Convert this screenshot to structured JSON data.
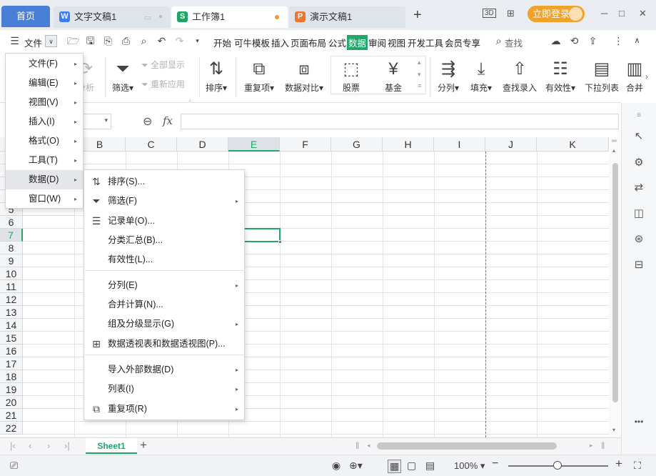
{
  "tabs": {
    "home": "首页",
    "docs": [
      {
        "label": "文字文稿1",
        "icon": "W",
        "color": "#3d7cf2"
      },
      {
        "label": "工作簿1",
        "icon": "S",
        "color": "#1fa463"
      },
      {
        "label": "演示文稿1",
        "icon": "P",
        "color": "#f0742d"
      }
    ],
    "add": "+"
  },
  "window": {
    "login": "立即登录",
    "minimize": "─",
    "maximize": "□",
    "close": "✕"
  },
  "menubar": {
    "file_label": "文件",
    "items": [
      "开始",
      "可牛模板",
      "插入",
      "页面布局",
      "公式",
      "数据",
      "审阅",
      "视图",
      "开发工具",
      "会员专享"
    ],
    "active": "数据",
    "search": "查找"
  },
  "ribbon": {
    "analysis_partial": "分析",
    "filter": "筛选",
    "show_all": "全部显示",
    "reapply": "重新应用",
    "sort": "排序",
    "duplicates": "重复项",
    "compare": "数据对比",
    "stock": "股票",
    "fund": "基金",
    "split": "分列",
    "fill": "填充",
    "lookup": "查找录入",
    "validity": "有效性",
    "dropdown": "下拉列表",
    "merge_partial": "合并"
  },
  "formula_bar": {
    "fx": "fx",
    "value": ""
  },
  "grid": {
    "columns": [
      "B",
      "C",
      "D",
      "E",
      "F",
      "G",
      "H",
      "I",
      "J",
      "K"
    ],
    "selected_column": "E",
    "rows": [
      "5",
      "6",
      "7",
      "8",
      "9",
      "10",
      "11",
      "12",
      "13",
      "14",
      "15",
      "16",
      "17",
      "18",
      "19",
      "20",
      "21",
      "22"
    ],
    "selected_row": "7"
  },
  "menu_level1": [
    {
      "label": "文件(F)"
    },
    {
      "label": "编辑(E)"
    },
    {
      "label": "视图(V)"
    },
    {
      "label": "插入(I)"
    },
    {
      "label": "格式(O)"
    },
    {
      "label": "工具(T)"
    },
    {
      "label": "数据(D)"
    },
    {
      "label": "窗口(W)"
    }
  ],
  "menu_data": [
    {
      "label": "排序(S)...",
      "icon": "sort"
    },
    {
      "label": "筛选(F)",
      "icon": "filter",
      "sub": true
    },
    {
      "label": "记录单(O)...",
      "icon": "record"
    },
    {
      "label": "分类汇总(B)..."
    },
    {
      "label": "有效性(L)..."
    },
    {
      "label": "分列(E)",
      "sub": true
    },
    {
      "label": "合并计算(N)..."
    },
    {
      "label": "组及分级显示(G)",
      "sub": true
    },
    {
      "label": "数据透视表和数据透视图(P)...",
      "icon": "pivot"
    },
    {
      "label": "导入外部数据(D)",
      "sub": true
    },
    {
      "label": "列表(I)",
      "sub": true
    },
    {
      "label": "重复项(R)",
      "icon": "duplicate",
      "sub": true
    }
  ],
  "sheets": {
    "active": "Sheet1",
    "add": "+"
  },
  "status": {
    "zoom": "100%",
    "minus": "−",
    "plus": "+"
  },
  "colors": {
    "accent": "#22a66a",
    "home_tab": "#4a7fd8",
    "login": "#f1a22a"
  }
}
